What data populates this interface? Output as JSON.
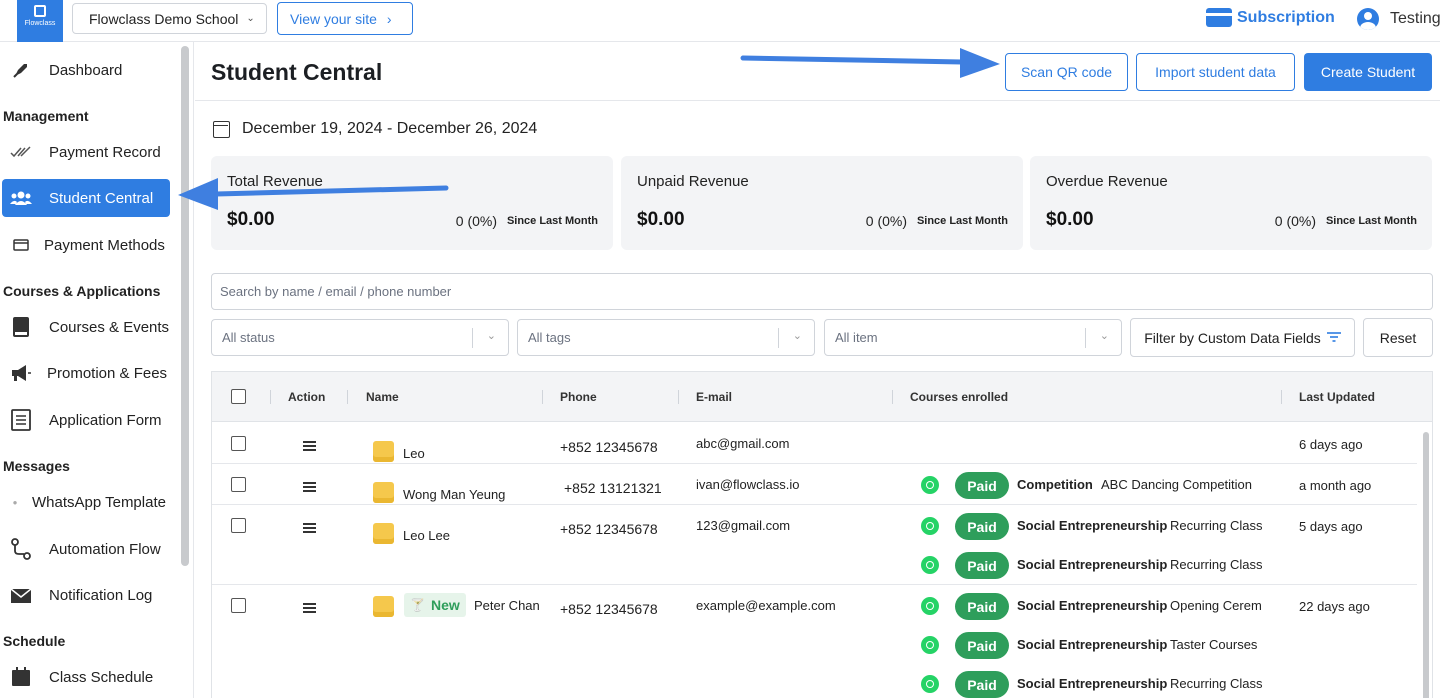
{
  "topbar": {
    "logo_text": "Flowclass",
    "school_name": "Flowclass Demo School",
    "view_site_label": "View your site",
    "subscription_label": "Subscription",
    "user_name": "Testing"
  },
  "sidebar": {
    "dashboard": "Dashboard",
    "section_management": "Management",
    "payment_record": "Payment Record",
    "student_central": "Student Central",
    "payment_methods": "Payment Methods",
    "section_courses": "Courses & Applications",
    "courses_events": "Courses & Events",
    "promotion_fees": "Promotion & Fees",
    "application_form": "Application Form",
    "section_messages": "Messages",
    "whatsapp_template": "WhatsApp Template",
    "automation_flow": "Automation Flow",
    "notification_log": "Notification Log",
    "section_schedule": "Schedule",
    "class_schedule": "Class Schedule"
  },
  "header": {
    "title": "Student Central",
    "scan_qr_label": "Scan QR code",
    "import_label": "Import student data",
    "create_label": "Create Student"
  },
  "date_range": "December 19, 2024 - December 26, 2024",
  "stats": [
    {
      "label": "Total Revenue",
      "amount": "$0.00",
      "change": "0 (0%)",
      "since": "Since Last Month"
    },
    {
      "label": "Unpaid Revenue",
      "amount": "$0.00",
      "change": "0 (0%)",
      "since": "Since Last Month"
    },
    {
      "label": "Overdue Revenue",
      "amount": "$0.00",
      "change": "0 (0%)",
      "since": "Since Last Month"
    }
  ],
  "search": {
    "placeholder": "Search by name / email / phone number"
  },
  "filters": {
    "status": "All status",
    "tags": "All tags",
    "item": "All item",
    "custom_fields_label": "Filter by Custom Data Fields",
    "reset_label": "Reset"
  },
  "table": {
    "columns": [
      "Action",
      "Name",
      "Phone",
      "E-mail",
      "Courses enrolled",
      "Last Updated"
    ],
    "rows": [
      {
        "name": "Leo",
        "phone": "+852 12345678",
        "email": "abc@gmail.com",
        "updated": "6 days ago",
        "courses": []
      },
      {
        "name": "Wong Man Yeung",
        "phone": "+852 13121321",
        "email": "ivan@flowclass.io",
        "updated": "a month ago",
        "courses": [
          {
            "status": "Paid",
            "course": "Competition",
            "item": "ABC Dancing Competition"
          }
        ]
      },
      {
        "name": "Leo Lee",
        "phone": "+852 12345678",
        "email": "123@gmail.com",
        "updated": "5 days ago",
        "courses": [
          {
            "status": "Paid",
            "course": "Social Entrepreneurship",
            "item": "Recurring Class"
          },
          {
            "status": "Paid",
            "course": "Social Entrepreneurship",
            "item": "Recurring Class"
          }
        ]
      },
      {
        "badge": "New",
        "name": "Peter Chan",
        "phone": "+852 12345678",
        "email": "example@example.com",
        "updated": "22 days ago",
        "courses": [
          {
            "status": "Paid",
            "course": "Social Entrepreneurship",
            "item": "Opening Cerem"
          },
          {
            "status": "Paid",
            "course": "Social Entrepreneurship",
            "item": "Taster Courses"
          },
          {
            "status": "Paid",
            "course": "Social Entrepreneurship",
            "item": "Recurring Class"
          }
        ]
      }
    ]
  },
  "colors": {
    "accent": "#2f7de1",
    "paid": "#2e9e5b",
    "whatsapp": "#25d366"
  }
}
